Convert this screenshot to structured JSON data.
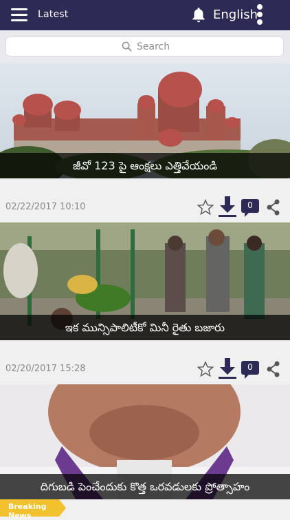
{
  "header": {
    "title": "Latest",
    "language": "English"
  },
  "search": {
    "placeholder": "Search"
  },
  "colors": {
    "header_bg": "#2d2a55",
    "accent": "#2d2a55",
    "breaking_bg": "#f2c12e"
  },
  "icons": [
    "menu-icon",
    "bell-icon",
    "more-vertical-icon",
    "search-icon",
    "star-icon",
    "download-icon",
    "comment-icon",
    "share-icon"
  ],
  "articles": [
    {
      "caption": "జీవో 123 పై ఆంక్షలు ఎత్తివేయండి"
    },
    {
      "date": "02/22/2017 10:10",
      "comments": "0",
      "caption": "ఇక మున్సిపాలిటీకో మినీ రైతు బజారు"
    },
    {
      "date": "02/20/2017 15:28",
      "comments": "0",
      "caption": "దిగుబడి పెంచేందుకు కొత్త ఒరవడులకు ప్రోత్సాహం"
    }
  ],
  "ticker": {
    "label": "Breaking News"
  }
}
